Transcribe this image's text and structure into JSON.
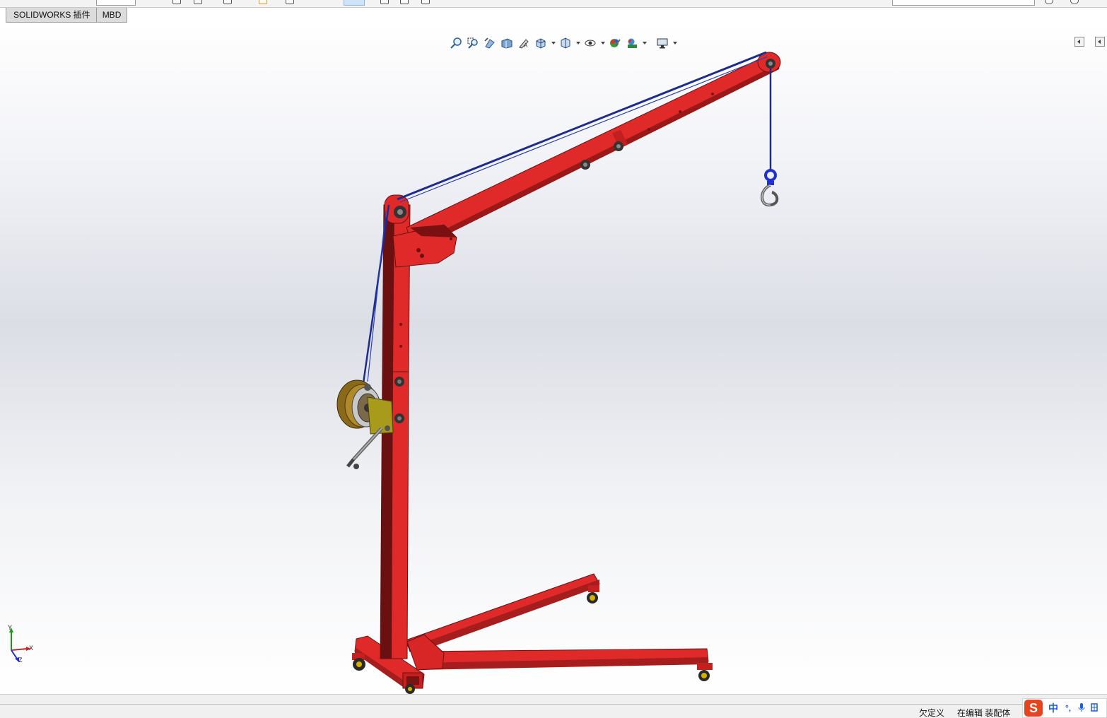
{
  "tabs": [
    {
      "label": "SOLIDWORKS 插件"
    },
    {
      "label": "MBD"
    }
  ],
  "hud_icons": [
    "zoom-to-fit-icon",
    "zoom-to-area-icon",
    "previous-view-icon",
    "section-view-icon",
    "dynamic-annotation-icon",
    "view-orientation-icon",
    "display-style-icon",
    "hide-show-items-icon",
    "edit-appearance-icon",
    "apply-scene-icon",
    "view-settings-icon"
  ],
  "triad": {
    "x": "X",
    "y": "Y",
    "z": "Z"
  },
  "status": {
    "definition": "欠定义",
    "mode": "在编辑 装配体"
  },
  "ime": {
    "logo": "S",
    "lang": "中",
    "punct": "°,",
    "mic_icon": "microphone-icon",
    "grid_icon": "toolbox-icon"
  },
  "colors": {
    "frame_red": "#e02a2a",
    "frame_dark": "#6b1010",
    "rope_blue": "#1d2c8c",
    "hook_blue": "#1f2fd0"
  }
}
